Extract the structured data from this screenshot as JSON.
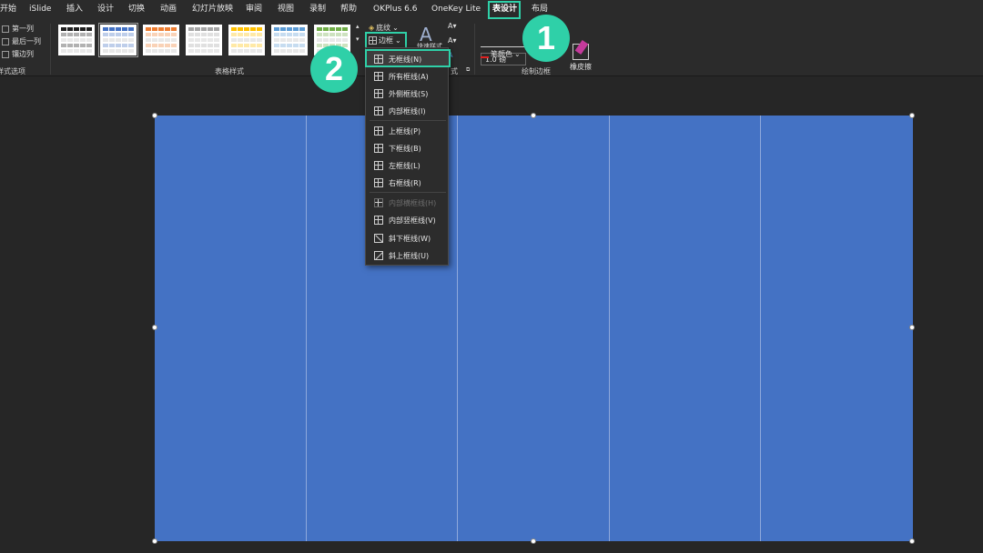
{
  "tabs": [
    "开始",
    "iSlide",
    "插入",
    "设计",
    "切换",
    "动画",
    "幻灯片放映",
    "审阅",
    "视图",
    "录制",
    "帮助",
    "OKPlus 6.6",
    "OneKey Lite",
    "表设计",
    "布局"
  ],
  "active_tab": "表设计",
  "style_options": {
    "items": [
      "第一列",
      "最后一列",
      "镶边列"
    ],
    "label": "样式选项"
  },
  "table_styles": {
    "label": "表格样式",
    "swatch_colors": [
      "#1f1f1f",
      "#4472c4",
      "#ed7d31",
      "#a5a5a5",
      "#ffc000",
      "#5b9bd5",
      "#70ad47"
    ]
  },
  "shading_label": "底纹",
  "border_label": "边框",
  "quick_styles_label": "快速样式",
  "art_group_label": "式",
  "draw_group": {
    "label": "绘制边框",
    "weight": "1.0 磅",
    "pen_color_label": "笔颜色",
    "eraser_label": "橡皮擦"
  },
  "badges": {
    "one": "1",
    "two": "2"
  },
  "border_menu": [
    {
      "label": "无框线(N)",
      "highlighted": true,
      "disabled": false
    },
    {
      "label": "所有框线(A)",
      "highlighted": false,
      "disabled": false
    },
    {
      "label": "外侧框线(S)",
      "highlighted": false,
      "disabled": false
    },
    {
      "label": "内部框线(I)",
      "highlighted": false,
      "disabled": false
    },
    {
      "label": "上框线(P)",
      "highlighted": false,
      "disabled": false
    },
    {
      "label": "下框线(B)",
      "highlighted": false,
      "disabled": false
    },
    {
      "label": "左框线(L)",
      "highlighted": false,
      "disabled": false
    },
    {
      "label": "右框线(R)",
      "highlighted": false,
      "disabled": false
    },
    {
      "label": "内部横框线(H)",
      "highlighted": false,
      "disabled": true
    },
    {
      "label": "内部竖框线(V)",
      "highlighted": false,
      "disabled": false
    },
    {
      "label": "斜下框线(W)",
      "highlighted": false,
      "disabled": false
    },
    {
      "label": "斜上框线(U)",
      "highlighted": false,
      "disabled": false
    }
  ],
  "colors": {
    "accent": "#2fd0a8",
    "table_fill": "#4472c4"
  }
}
